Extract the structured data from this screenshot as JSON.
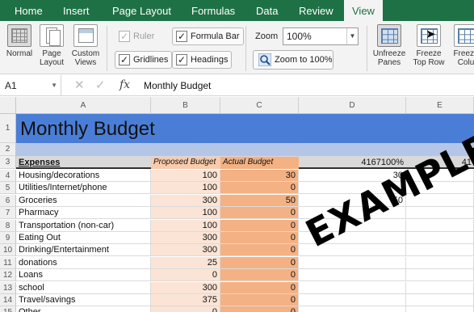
{
  "ribbon_tabs": [
    {
      "label": "Home",
      "active": false
    },
    {
      "label": "Insert",
      "active": false
    },
    {
      "label": "Page Layout",
      "active": false
    },
    {
      "label": "Formulas",
      "active": false
    },
    {
      "label": "Data",
      "active": false
    },
    {
      "label": "Review",
      "active": false
    },
    {
      "label": "View",
      "active": true
    }
  ],
  "view_ribbon": {
    "normal_label": "Normal",
    "page_layout_label": "Page\nLayout",
    "custom_views_label": "Custom\nViews",
    "ruler_label": "Ruler",
    "gridlines_label": "Gridlines",
    "formula_bar_label": "Formula Bar",
    "headings_label": "Headings",
    "zoom_label": "Zoom",
    "zoom_value": "100%",
    "zoom_to_100_label": "Zoom to 100%",
    "unfreeze_panes_label": "Unfreeze\nPanes",
    "freeze_top_row_label": "Freeze\nTop Row",
    "freeze_first_column_label": "Freeze\nColu"
  },
  "formula_bar": {
    "cell_ref": "A1",
    "fx": "fx",
    "cancel": "✕",
    "enter": "✓",
    "value": "Monthly Budget"
  },
  "columns": [
    "A",
    "B",
    "C",
    "D",
    "E"
  ],
  "sheet": {
    "title": "Monthly Budget",
    "headers": {
      "expenses": "Expenses",
      "proposed": "Proposed Budget",
      "actual": "Actual Budget",
      "d": "4167100%",
      "e": "41"
    },
    "rows": [
      {
        "row": "4",
        "expense": "Housing/decorations",
        "proposed": "100",
        "actual": "30",
        "d": "30"
      },
      {
        "row": "5",
        "expense": "Utilities/Internet/phone",
        "proposed": "100",
        "actual": "0",
        "d": ""
      },
      {
        "row": "6",
        "expense": "Groceries",
        "proposed": "300",
        "actual": "50",
        "d": "50"
      },
      {
        "row": "7",
        "expense": "Pharmacy",
        "proposed": "100",
        "actual": "0",
        "d": ""
      },
      {
        "row": "8",
        "expense": "Transportation (non-car)",
        "proposed": "100",
        "actual": "0",
        "d": ""
      },
      {
        "row": "9",
        "expense": "Eating Out",
        "proposed": "300",
        "actual": "0",
        "d": ""
      },
      {
        "row": "10",
        "expense": "Drinking/Entertainment",
        "proposed": "300",
        "actual": "0",
        "d": ""
      },
      {
        "row": "11",
        "expense": "donations",
        "proposed": "25",
        "actual": "0",
        "d": ""
      },
      {
        "row": "12",
        "expense": "Loans",
        "proposed": "0",
        "actual": "0",
        "d": ""
      },
      {
        "row": "13",
        "expense": "school",
        "proposed": "300",
        "actual": "0",
        "d": ""
      },
      {
        "row": "14",
        "expense": "Travel/savings",
        "proposed": "375",
        "actual": "0",
        "d": ""
      },
      {
        "row": "15",
        "expense": "Other",
        "proposed": "0",
        "actual": "0",
        "d": ""
      }
    ]
  },
  "watermark": "EXAMPLE!",
  "colors": {
    "ribbon_green": "#1e7145",
    "title_blue": "#4a7ed6",
    "proposed_fill": "#fbe4d5",
    "actual_fill": "#f4b183"
  }
}
